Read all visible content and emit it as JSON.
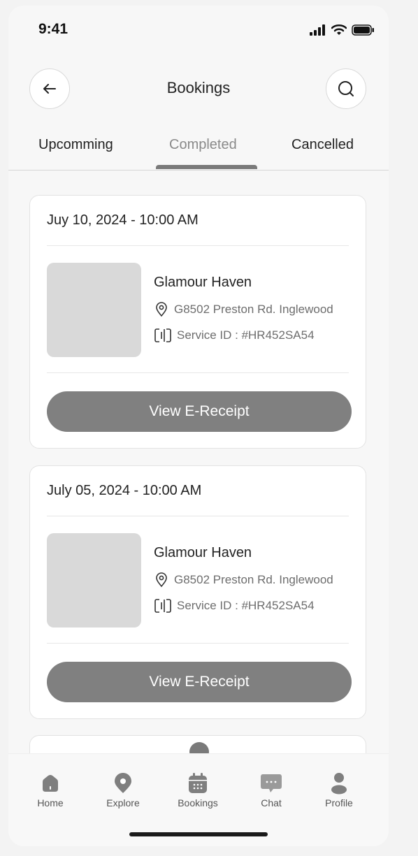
{
  "status_bar": {
    "time": "9:41"
  },
  "header": {
    "title": "Bookings"
  },
  "tabs": [
    {
      "label": "Upcomming",
      "active": false
    },
    {
      "label": "Completed",
      "active": true
    },
    {
      "label": "Cancelled",
      "active": false
    }
  ],
  "bookings": [
    {
      "date": "Juy 10, 2024 - 10:00 AM",
      "name": "Glamour Haven",
      "address": "G8502 Preston Rd. Inglewood",
      "service_id": "Service ID : #HR452SA54",
      "button_label": "View E-Receipt"
    },
    {
      "date": "July 05, 2024 - 10:00 AM",
      "name": "Glamour Haven",
      "address": "G8502 Preston Rd. Inglewood",
      "service_id": "Service ID : #HR452SA54",
      "button_label": "View E-Receipt"
    }
  ],
  "bottom_nav": [
    {
      "label": "Home",
      "icon": "home-icon"
    },
    {
      "label": "Explore",
      "icon": "location-pin-icon"
    },
    {
      "label": "Bookings",
      "icon": "calendar-icon"
    },
    {
      "label": "Chat",
      "icon": "chat-icon"
    },
    {
      "label": "Profile",
      "icon": "user-icon"
    }
  ],
  "colors": {
    "primary_button": "#808080",
    "placeholder": "#d9d9d9",
    "background": "#f7f7f7"
  }
}
